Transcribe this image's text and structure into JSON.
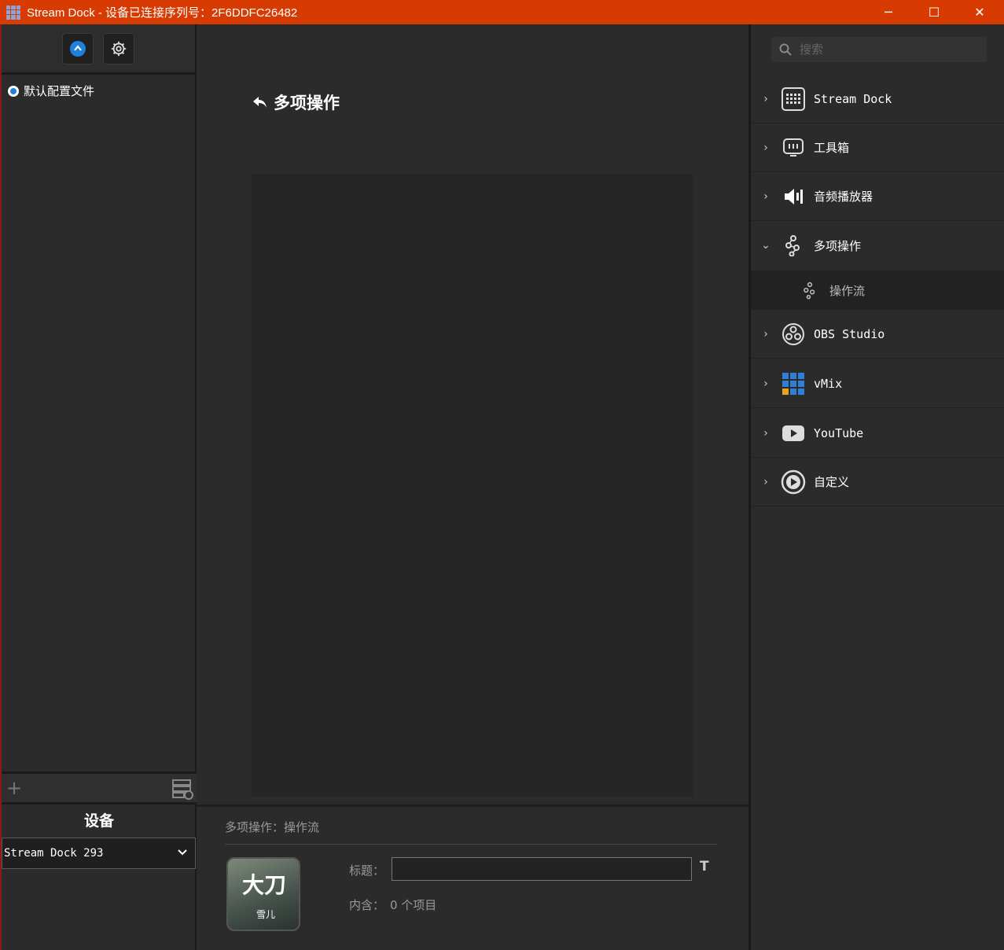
{
  "window": {
    "title": "Stream Dock - 设备已连接序列号：2F6DDFC26482",
    "minimize": "─",
    "maximize": "☐",
    "close": "✕"
  },
  "left": {
    "profile_label": "默认配置文件",
    "device_title": "设备",
    "device_selected": "Stream Dock 293"
  },
  "center": {
    "back_title": "多项操作",
    "bottom_title": "多项操作：操作流",
    "thumb_big": "大刀",
    "thumb_small": "雪儿",
    "title_label": "标题：",
    "title_value": "",
    "text_button": "T",
    "contains_label": "内含：",
    "contains_value": "0 个项目"
  },
  "right": {
    "search_placeholder": "搜索",
    "categories": [
      {
        "label": "Stream Dock",
        "icon": "keypad-icon",
        "expanded": false
      },
      {
        "label": "工具箱",
        "icon": "toolbox-icon",
        "expanded": false
      },
      {
        "label": "音频播放器",
        "icon": "speaker-icon",
        "expanded": false
      },
      {
        "label": "多项操作",
        "icon": "multi-action-icon",
        "expanded": true
      },
      {
        "label": "OBS Studio",
        "icon": "obs-icon",
        "expanded": false
      },
      {
        "label": "vMix",
        "icon": "vmix-icon",
        "expanded": false
      },
      {
        "label": "YouTube",
        "icon": "youtube-icon",
        "expanded": false
      },
      {
        "label": "自定义",
        "icon": "custom-icon",
        "expanded": false
      }
    ],
    "sub_item": {
      "label": "操作流",
      "icon": "flow-icon"
    }
  },
  "colors": {
    "titlebar": "#d83b01",
    "accent": "#1f7fd9"
  }
}
